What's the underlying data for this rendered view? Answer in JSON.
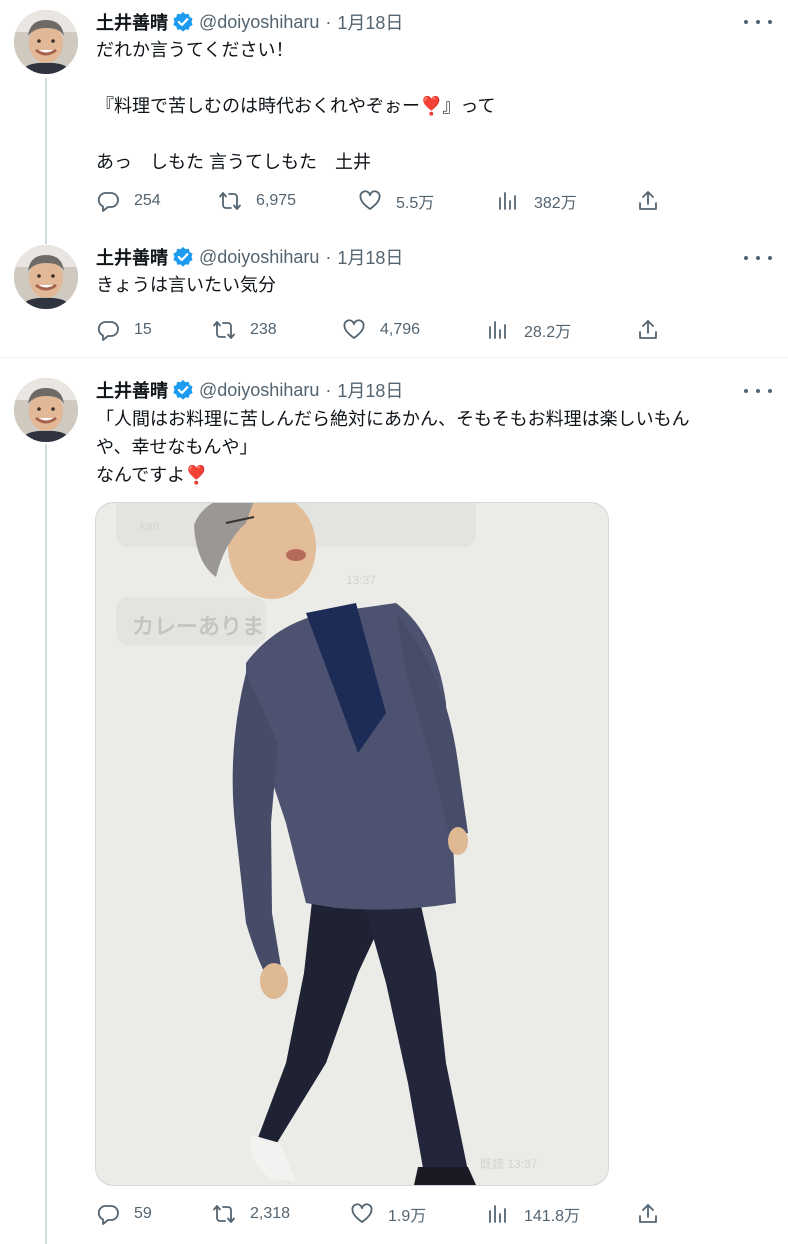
{
  "tweets": [
    {
      "author": {
        "name": "土井善晴",
        "handle": "@doiyoshiharu",
        "date": "1月18日",
        "verified": true
      },
      "lines": [
        "だれか言うてください！",
        "",
        "『料理で苦しむのは時代おくれやぞぉー",
        "』って",
        "",
        "あっ　しもた 言うてしもた　土井"
      ],
      "stats": {
        "replies": "254",
        "retweets": "6,975",
        "likes": "5.5万",
        "views": "382万"
      }
    },
    {
      "author": {
        "name": "土井善晴",
        "handle": "@doiyoshiharu",
        "date": "1月18日",
        "verified": true
      },
      "lines": [
        "きょうは言いたい気分"
      ],
      "stats": {
        "replies": "15",
        "retweets": "238",
        "likes": "4,796",
        "views": "28.2万"
      }
    },
    {
      "author": {
        "name": "土井善晴",
        "handle": "@doiyoshiharu",
        "date": "1月18日",
        "verified": true
      },
      "lines": [
        "「人間はお料理に苦しんだら絶対にあかん、そもそもお料理は楽しいもん",
        "や、幸せなもんや」",
        "なんですよ"
      ],
      "media": {
        "chat_text": "カレーありま",
        "chat_time": "13:37",
        "chat_stamp": "既読 13:37",
        "chat_top": "kan"
      },
      "stats": {
        "replies": "59",
        "retweets": "2,318",
        "likes": "1.9万",
        "views": "141.8万"
      }
    }
  ],
  "emoji": {
    "heavy_heart_exclamation": "❣️"
  },
  "colors": {
    "text": "#0f1419",
    "muted": "#536471",
    "verified": "#1d9bf0",
    "heart_emoji": "#d73a4a",
    "thread_line": "#cfd9de"
  },
  "icons": {
    "reply": "reply-icon",
    "retweet": "retweet-icon",
    "like": "heart-icon",
    "views": "views-icon",
    "share": "share-icon",
    "more": "more-icon",
    "verified": "verified-badge-icon"
  }
}
